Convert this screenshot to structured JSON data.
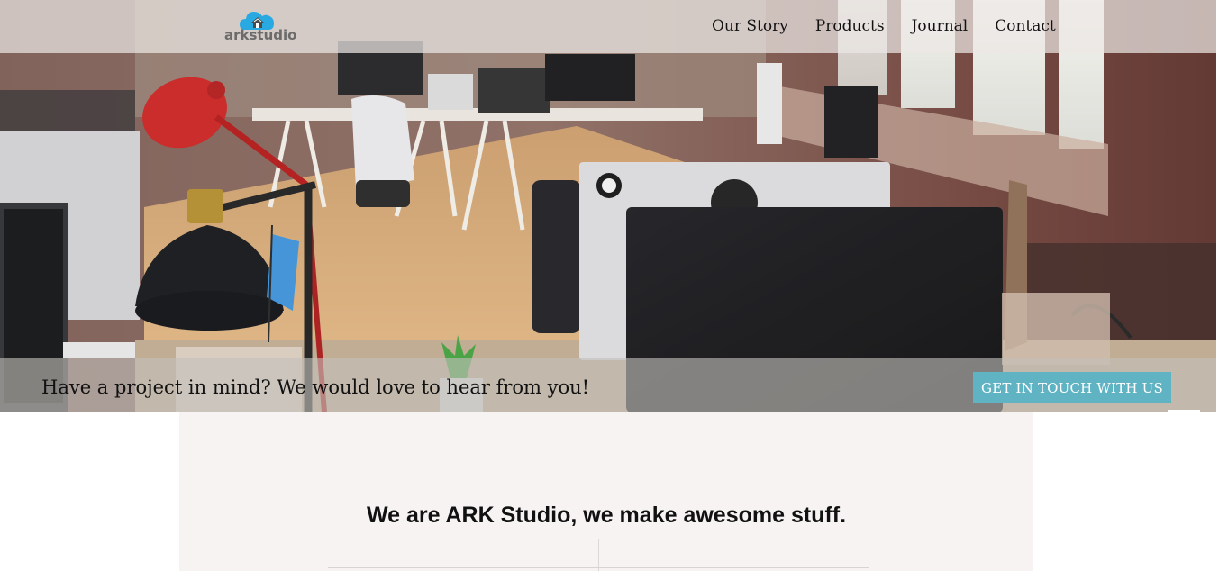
{
  "header": {
    "logo_text": "arkstudio",
    "nav": [
      {
        "label": "Our Story"
      },
      {
        "label": "Products"
      },
      {
        "label": "Journal"
      },
      {
        "label": "Contact"
      }
    ]
  },
  "hero": {
    "cta_text": "Have a project in mind? We would love to hear from you!",
    "cta_button": "GET IN TOUCH WITH US"
  },
  "main": {
    "tagline": "We are ARK Studio, we make awesome stuff."
  },
  "colors": {
    "accent": "#5fb3c2",
    "logo_cloud": "#29a9e1",
    "content_bg": "#f6f3f2"
  },
  "icons": {
    "logo": "cloud-house-icon"
  }
}
